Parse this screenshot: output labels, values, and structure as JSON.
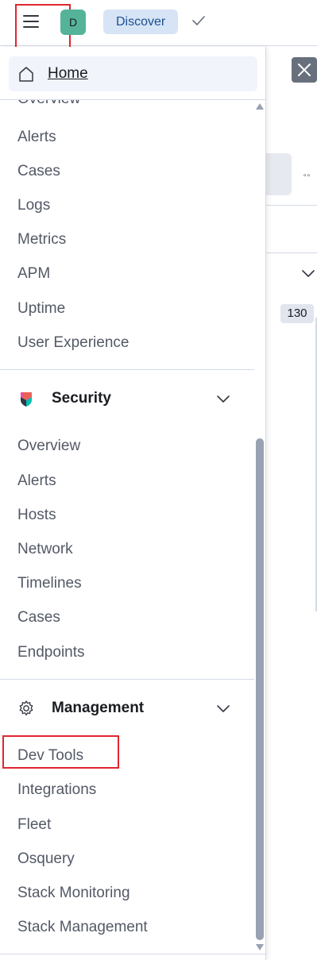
{
  "header": {
    "avatar_initial": "D",
    "breadcrumb": "Discover"
  },
  "background": {
    "badge_count": "130",
    "dots": "▫▫"
  },
  "nav": {
    "home_label": "Home",
    "observability_items": [
      "Overview",
      "Alerts",
      "Cases",
      "Logs",
      "Metrics",
      "APM",
      "Uptime",
      "User Experience"
    ],
    "security": {
      "title": "Security",
      "items": [
        "Overview",
        "Alerts",
        "Hosts",
        "Network",
        "Timelines",
        "Cases",
        "Endpoints"
      ]
    },
    "management": {
      "title": "Management",
      "items": [
        "Dev Tools",
        "Integrations",
        "Fleet",
        "Osquery",
        "Stack Monitoring",
        "Stack Management"
      ]
    }
  },
  "colors": {
    "accent_red": "#e0262f",
    "avatar_bg": "#54b399",
    "breadcrumb_bg": "#d6e4f5",
    "breadcrumb_text": "#1d4f91"
  }
}
